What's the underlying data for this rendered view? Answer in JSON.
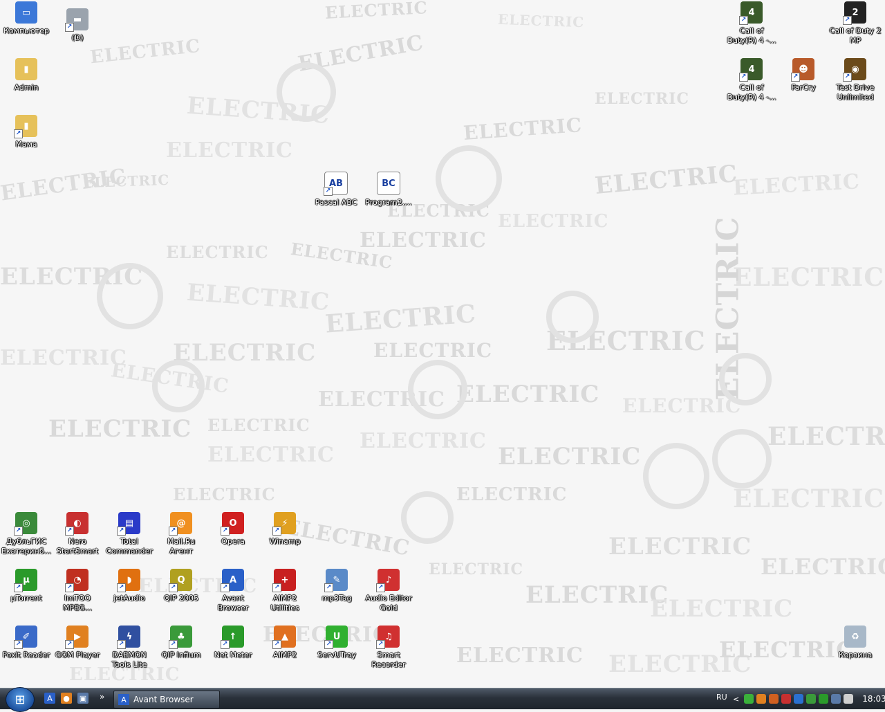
{
  "desktop": {
    "wallpaper_word": "ELECTRIC",
    "icons_top_left": [
      {
        "name": "computer",
        "label": "Компьютер",
        "color": "#3c78d8",
        "glyph": "▭"
      },
      {
        "name": "drive-d",
        "label": "(D)",
        "color": "#9aa3ad",
        "glyph": "▬"
      },
      {
        "name": "folder-admin",
        "label": "Admin",
        "color": "#e6c15a",
        "glyph": "▮"
      },
      {
        "name": "folder-mama",
        "label": "Мама",
        "color": "#e6c15a",
        "glyph": "▮"
      }
    ],
    "icons_center": [
      {
        "name": "pascal-abc",
        "label": "Pascal ABC",
        "color": "#ffffff",
        "glyph": "AB"
      },
      {
        "name": "program2",
        "label": "Program2....",
        "color": "#ffffff",
        "glyph": "BC"
      }
    ],
    "icons_top_right": [
      {
        "name": "call-of-duty-4-a",
        "label": "Call of Duty(R) 4 -...",
        "color": "#3a5a2a",
        "glyph": "4"
      },
      {
        "name": "call-of-duty-2-mp",
        "label": "Call of Duty 2 MP",
        "color": "#222222",
        "glyph": "2"
      },
      {
        "name": "call-of-duty-4-b",
        "label": "Call of Duty(R) 4 -...",
        "color": "#3a5a2a",
        "glyph": "4"
      },
      {
        "name": "farcry",
        "label": "FarCry",
        "color": "#b85a2a",
        "glyph": "☻"
      },
      {
        "name": "test-drive-unlimited",
        "label": "Test Drive Unlimited",
        "color": "#6b4a1a",
        "glyph": "◉"
      }
    ],
    "icons_bottom": [
      {
        "name": "dublgis",
        "label": "ДубльГИС Екатеринб...",
        "color": "#3a8a3a",
        "glyph": "◎"
      },
      {
        "name": "nero",
        "label": "Nero StartSmart",
        "color": "#c83030",
        "glyph": "◐"
      },
      {
        "name": "total-commander",
        "label": "Total Commander",
        "color": "#2a3ac8",
        "glyph": "▤"
      },
      {
        "name": "mailru-agent",
        "label": "Mail.Ru Агент",
        "color": "#f09020",
        "glyph": "@"
      },
      {
        "name": "opera",
        "label": "Opera",
        "color": "#d02020",
        "glyph": "O"
      },
      {
        "name": "winamp",
        "label": "Winamp",
        "color": "#e0a020",
        "glyph": "⚡"
      },
      {
        "name": "utorrent",
        "label": "µTorrent",
        "color": "#2a9a2a",
        "glyph": "µ"
      },
      {
        "name": "imtoo",
        "label": "ImTOO MPEG...",
        "color": "#c03020",
        "glyph": "◔"
      },
      {
        "name": "jetaudio",
        "label": "jetAudio",
        "color": "#e07010",
        "glyph": "◗"
      },
      {
        "name": "qip-2005",
        "label": "QIP 2005",
        "color": "#b0a020",
        "glyph": "Q"
      },
      {
        "name": "avant-browser-icon",
        "label": "Avant Browser",
        "color": "#2a60c8",
        "glyph": "A"
      },
      {
        "name": "aimp2-utilities",
        "label": "AIMP2 Utilities",
        "color": "#c82020",
        "glyph": "+"
      },
      {
        "name": "mp3tag",
        "label": "mp3Tag",
        "color": "#5a8ac8",
        "glyph": "✎"
      },
      {
        "name": "audio-editor-gold",
        "label": "Audio Editor Gold",
        "color": "#d03030",
        "glyph": "♪"
      },
      {
        "name": "foxit-reader",
        "label": "Foxit Reader",
        "color": "#3a6ac8",
        "glyph": "✐"
      },
      {
        "name": "gom-player",
        "label": "GOM Player",
        "color": "#e08020",
        "glyph": "▶"
      },
      {
        "name": "daemon-tools",
        "label": "DAEMON Tools Lite",
        "color": "#3050a0",
        "glyph": "ϟ"
      },
      {
        "name": "qip-infium",
        "label": "QIP Infium",
        "color": "#3a9a3a",
        "glyph": "♣"
      },
      {
        "name": "net-meter",
        "label": "Net Meter",
        "color": "#2a9a2a",
        "glyph": "↑"
      },
      {
        "name": "aimp2",
        "label": "AIMP2",
        "color": "#e07020",
        "glyph": "▲"
      },
      {
        "name": "servutray",
        "label": "ServUTray",
        "color": "#30b030",
        "glyph": "U"
      },
      {
        "name": "smart-recorder",
        "label": "Smart Recorder",
        "color": "#d03030",
        "glyph": "♫"
      }
    ],
    "recycle_bin": {
      "label": "Корзина"
    }
  },
  "taskbar": {
    "start_label": "Start",
    "quick_launch": [
      {
        "name": "avant-ql-icon",
        "color": "#2a60c8",
        "glyph": "A"
      },
      {
        "name": "firefox-ql-icon",
        "color": "#e08020",
        "glyph": "●"
      },
      {
        "name": "show-desktop-icon",
        "color": "#5a7aa8",
        "glyph": "▣"
      }
    ],
    "overflow": "»",
    "task_button": {
      "label": "Avant Browser",
      "icon_glyph": "A"
    },
    "language": "RU",
    "tray_chevron": "<",
    "tray_icons": [
      "#3ab03a",
      "#e08020",
      "#d06020",
      "#c83030",
      "#2a70d0",
      "#3a9a3a",
      "#2a9a2a",
      "#5a7aa8",
      "#d0d0d0"
    ],
    "clock": "18:03"
  }
}
